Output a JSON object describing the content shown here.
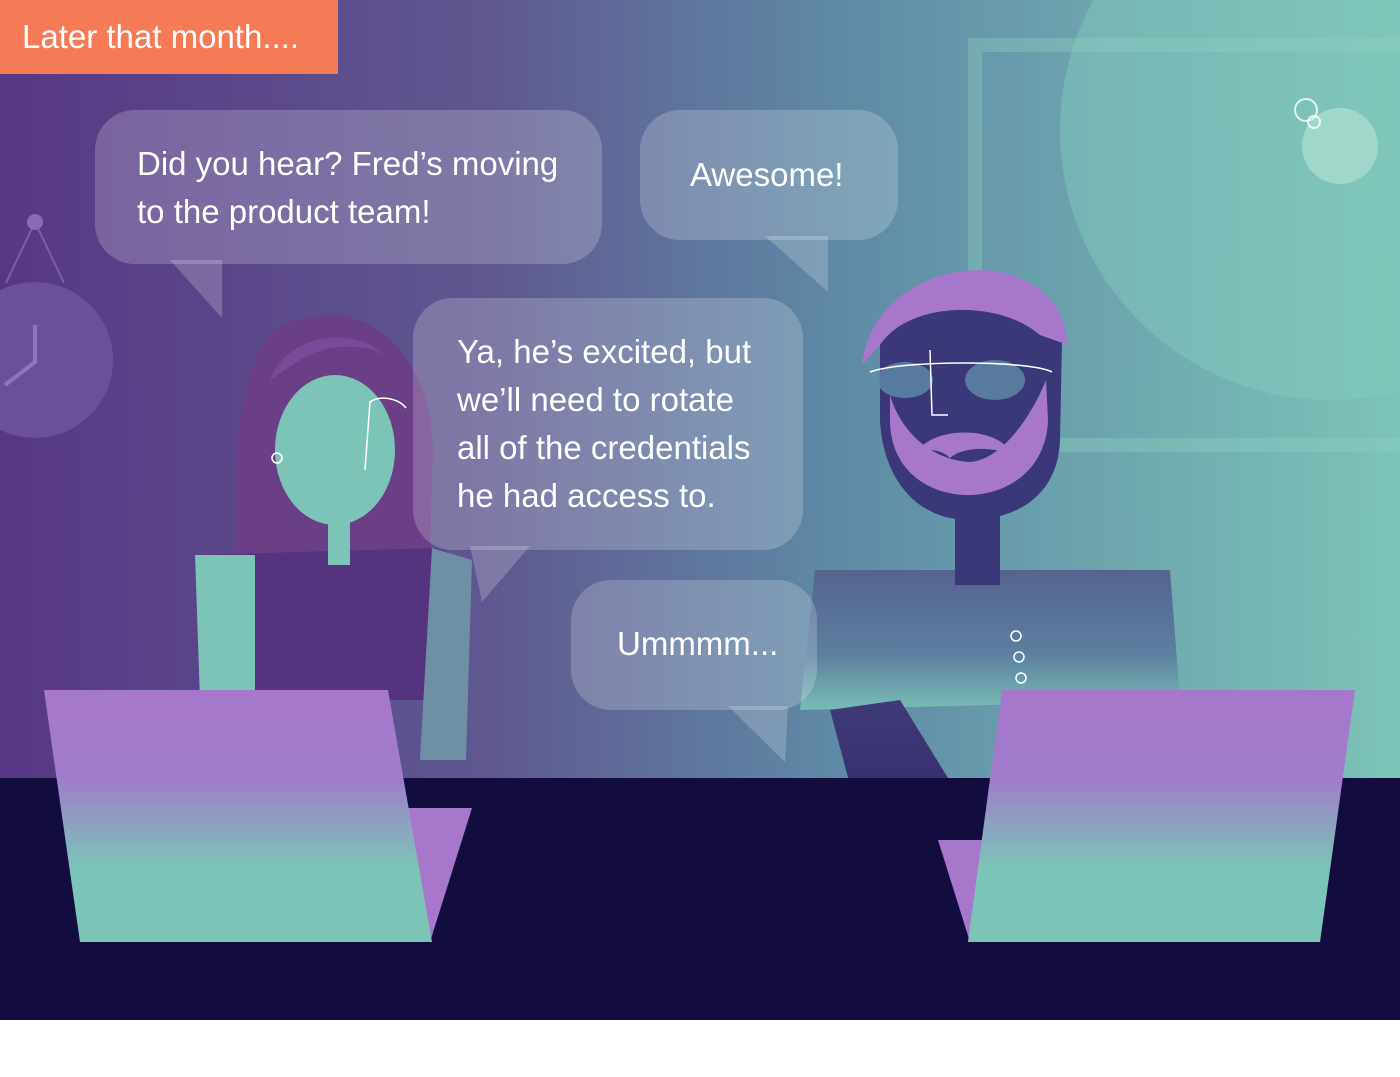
{
  "caption": {
    "text": "Later that month...."
  },
  "dialogue": [
    {
      "speaker": "woman",
      "lines": [
        "Did you hear? Fred’s moving",
        "to the product team!"
      ]
    },
    {
      "speaker": "man",
      "lines": [
        "Awesome!"
      ]
    },
    {
      "speaker": "woman",
      "lines": [
        "Ya, he’s excited, but",
        "we’ll need to rotate",
        "all of the credentials",
        "he had access to."
      ]
    },
    {
      "speaker": "man",
      "lines": [
        "Ummmm..."
      ]
    }
  ],
  "colors": {
    "caption_bg": "#f47b56",
    "wall_left": "#5a3a86",
    "wall_right": "#7cc3b8",
    "desk": "#130d3f",
    "laptop_top": "#a777cc",
    "laptop_bottom": "#7cc3b8",
    "bubble_fill": "#ffffff"
  }
}
